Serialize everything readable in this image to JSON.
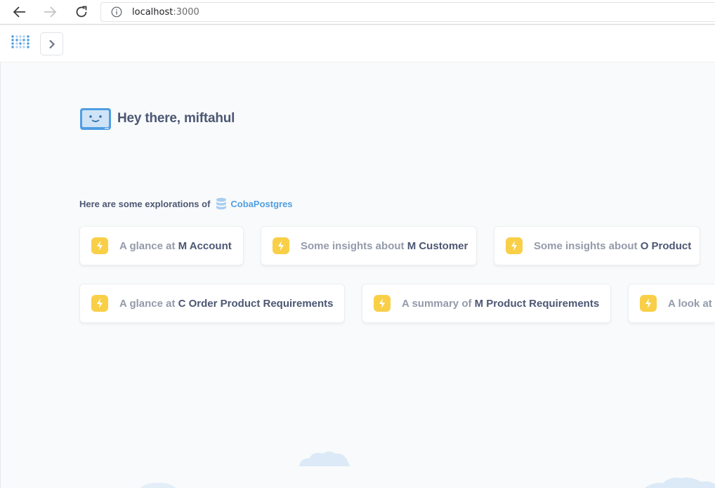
{
  "browser": {
    "url_host": "localhost",
    "url_port": ":3000",
    "icons": [
      "back-arrow-icon",
      "forward-arrow-icon",
      "reload-icon",
      "info-icon"
    ]
  },
  "app": {
    "logo_icon": "metabase-logo-icon",
    "toggle_icon": "chevron-right-icon"
  },
  "greeting": {
    "text": "Hey there, miftahul"
  },
  "explorations": {
    "heading": "Here are some explorations of",
    "database": "CobaPostgres",
    "cards": [
      {
        "prefix": "A glance at ",
        "name": "M Account"
      },
      {
        "prefix": "Some insights about ",
        "name": "M Customer"
      },
      {
        "prefix": "Some insights about ",
        "name": "O Product"
      },
      {
        "prefix": "A glance at ",
        "name": "C Order Product Requirements"
      },
      {
        "prefix": "A summary of ",
        "name": "M Product Requirements"
      },
      {
        "prefix": "A look at ",
        "name": ""
      }
    ]
  },
  "colors": {
    "brand": "#509ee3",
    "bolt": "#f9cf48",
    "text_dark": "#4c5773",
    "text_light": "#949aab",
    "background": "#f9fafb"
  }
}
